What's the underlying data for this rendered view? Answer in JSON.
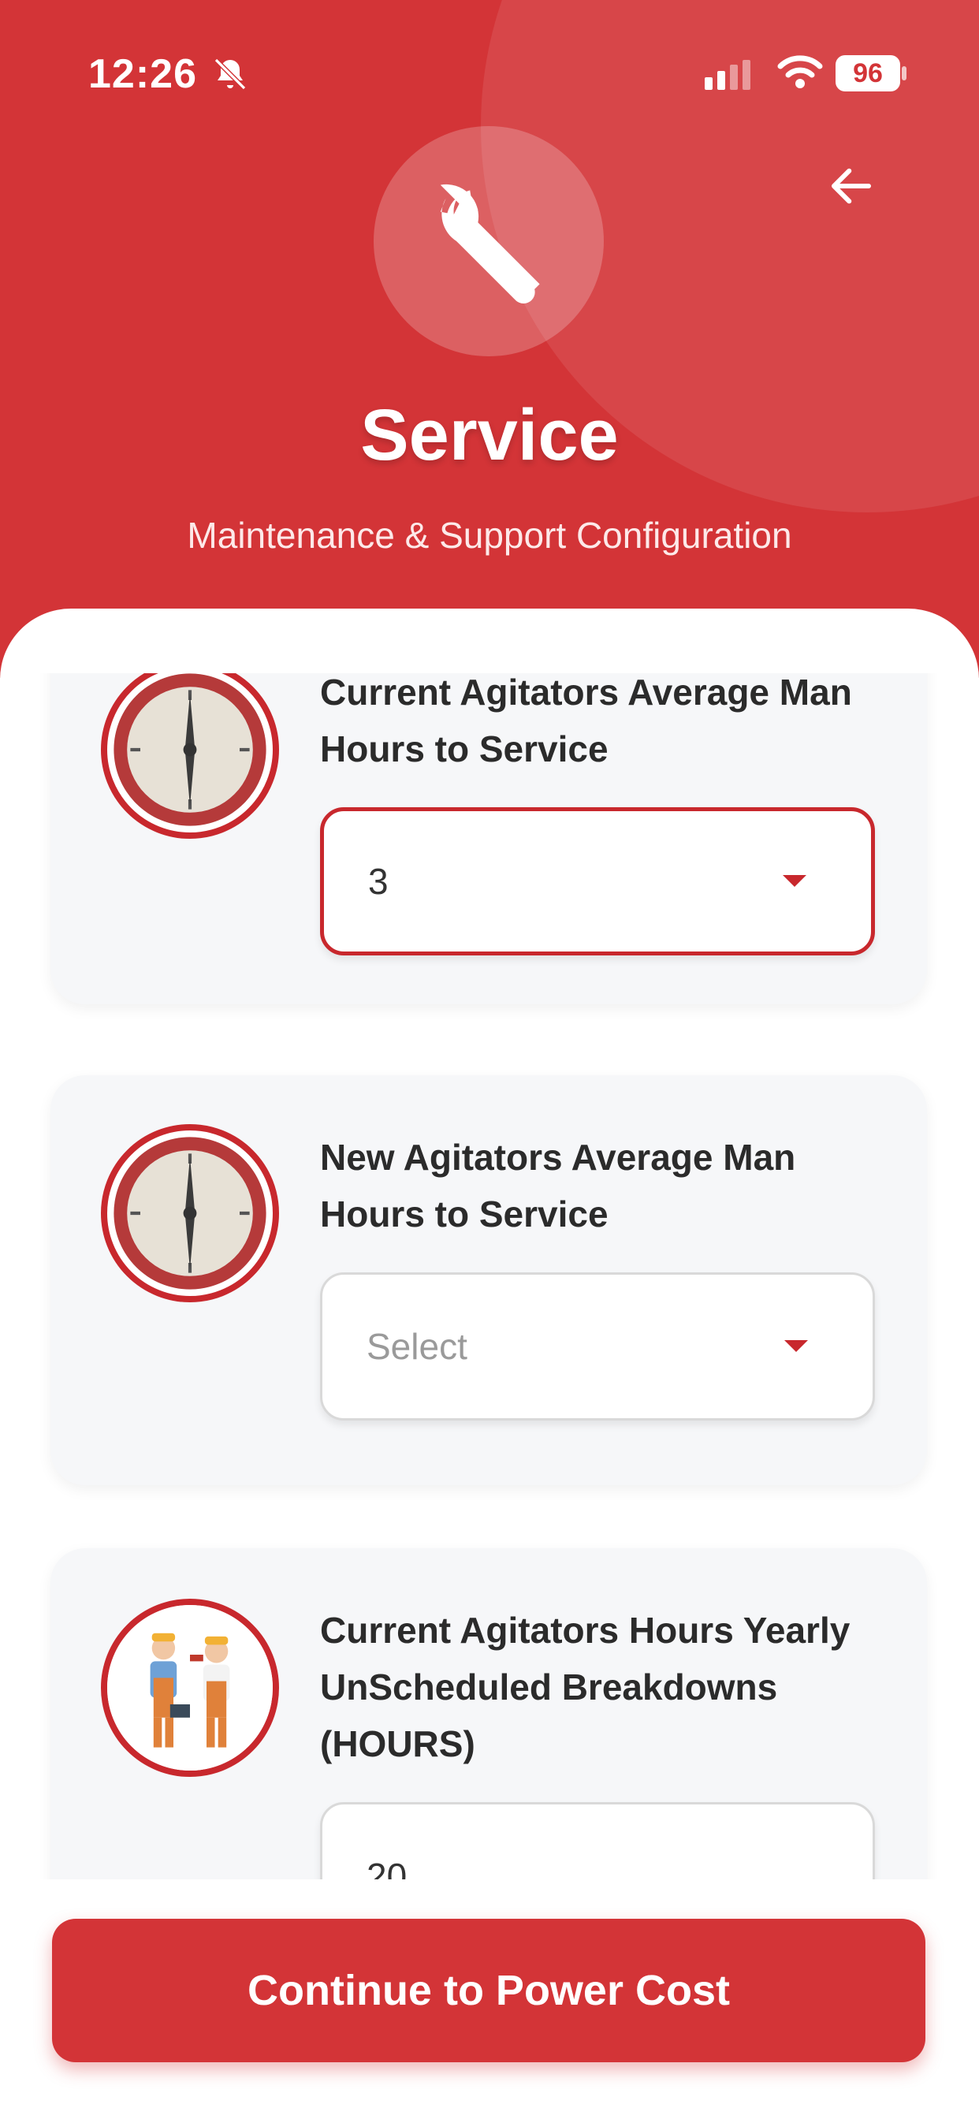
{
  "status_bar": {
    "time": "12:26",
    "battery": "96",
    "icons": [
      "bell-off-icon",
      "signal-icon",
      "wifi-icon",
      "battery-icon"
    ]
  },
  "header": {
    "icon": "wrench-icon",
    "title": "Service",
    "subtitle": "Maintenance & Support Configuration",
    "back_icon": "arrow-left-icon",
    "color": "#d33437"
  },
  "cards": [
    {
      "label": "Current Agitators Average Man Hours to Service",
      "value": "3",
      "placeholder": "",
      "icon": "clock-icon"
    },
    {
      "label": "New Agitators Average Man Hours to Service",
      "value": "",
      "placeholder": "Select",
      "icon": "clock-icon"
    },
    {
      "label": "Current Agitators Hours Yearly UnScheduled Breakdowns (HOURS)",
      "value": "20",
      "placeholder": "",
      "icon": "technicians-icon"
    }
  ],
  "footer": {
    "continue_label": "Continue to Power Cost"
  }
}
